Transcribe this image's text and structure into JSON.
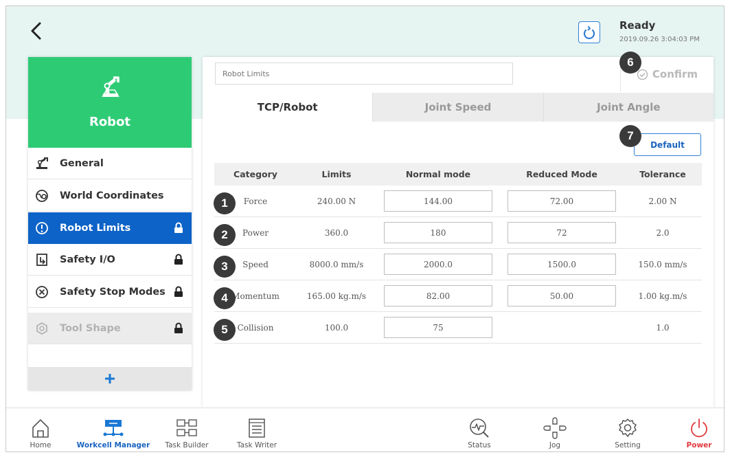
{
  "header": {
    "status_title": "Ready",
    "status_time": "2019.09.26 3:04:03 PM"
  },
  "sidebar": {
    "title": "Robot",
    "items": [
      {
        "label": "General",
        "icon": "robot-arm-icon",
        "locked": false,
        "state": "normal"
      },
      {
        "label": "World Coordinates",
        "icon": "globe-gear-icon",
        "locked": false,
        "state": "normal"
      },
      {
        "label": "Robot Limits",
        "icon": "limit-icon",
        "locked": true,
        "state": "active"
      },
      {
        "label": "Safety I/O",
        "icon": "io-icon",
        "locked": true,
        "state": "normal"
      },
      {
        "label": "Safety Stop Modes",
        "icon": "stop-circle-icon",
        "locked": true,
        "state": "normal"
      },
      {
        "label": "Tool Shape",
        "icon": "tool-shape-icon",
        "locked": true,
        "state": "disabled"
      }
    ],
    "add_label": "+"
  },
  "main": {
    "name_placeholder": "Robot Limits",
    "confirm_label": "Confirm",
    "tabs": [
      {
        "label": "TCP/Robot",
        "active": true
      },
      {
        "label": "Joint Speed",
        "active": false
      },
      {
        "label": "Joint Angle",
        "active": false
      }
    ],
    "default_label": "Default",
    "table": {
      "headers": [
        "Category",
        "Limits",
        "Normal mode",
        "Reduced Mode",
        "Tolerance"
      ],
      "rows": [
        {
          "badge": "1",
          "category": "Force",
          "limits": "240.00 N",
          "normal": "144.00",
          "reduced": "72.00",
          "tolerance": "2.00 N"
        },
        {
          "badge": "2",
          "category": "Power",
          "limits": "360.0",
          "normal": "180",
          "reduced": "72",
          "tolerance": "2.0"
        },
        {
          "badge": "3",
          "category": "Speed",
          "limits": "8000.0 mm/s",
          "normal": "2000.0",
          "reduced": "1500.0",
          "tolerance": "150.0 mm/s"
        },
        {
          "badge": "4",
          "category": "Momentum",
          "limits": "165.00 kg.m/s",
          "normal": "82.00",
          "reduced": "50.00",
          "tolerance": "1.00 kg.m/s"
        },
        {
          "badge": "5",
          "category": "Collision",
          "limits": "100.0",
          "normal": "75",
          "reduced": "",
          "tolerance": "1.0"
        }
      ]
    },
    "badge_confirm": "6",
    "badge_default": "7"
  },
  "bottom_nav": {
    "items": [
      {
        "label": "Home",
        "icon": "home-icon"
      },
      {
        "label": "Workcell Manager",
        "icon": "workcell-icon"
      },
      {
        "label": "Task Builder",
        "icon": "task-builder-icon"
      },
      {
        "label": "Task Writer",
        "icon": "task-writer-icon"
      },
      {
        "label": "Status",
        "icon": "status-icon"
      },
      {
        "label": "Jog",
        "icon": "jog-icon"
      },
      {
        "label": "Setting",
        "icon": "gear-icon"
      },
      {
        "label": "Power",
        "icon": "power-icon"
      }
    ]
  },
  "colors": {
    "accent_green": "#2ecb75",
    "active_blue": "#0d63c7",
    "band_teal": "#e6f4f2",
    "power_red": "#e0393e"
  }
}
